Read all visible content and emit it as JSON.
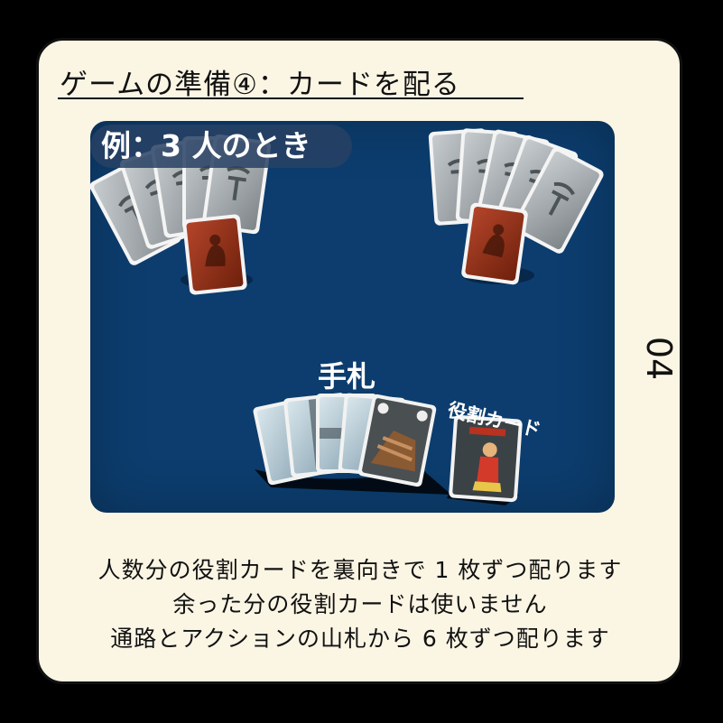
{
  "title": "ゲームの準備④：カードを配る",
  "example_label": "例：3 人のとき",
  "hand_label": "手札",
  "role_card_label": "役割カード",
  "page_number": "04",
  "descriptions": [
    "人数分の役割カードを裏向きで 1 枚ずつ配ります",
    "余った分の役割カードは使いません",
    "通路とアクションの山札から 6 枚ずつ配ります"
  ],
  "colors": {
    "frame_bg": "#fbf5e4",
    "board_bg": "#0c3d6e",
    "role_card_back": "#8a2e14",
    "card_back_gray": "#9aa2a6"
  },
  "icons": [
    "pickaxe-icon",
    "dwarf-icon"
  ]
}
